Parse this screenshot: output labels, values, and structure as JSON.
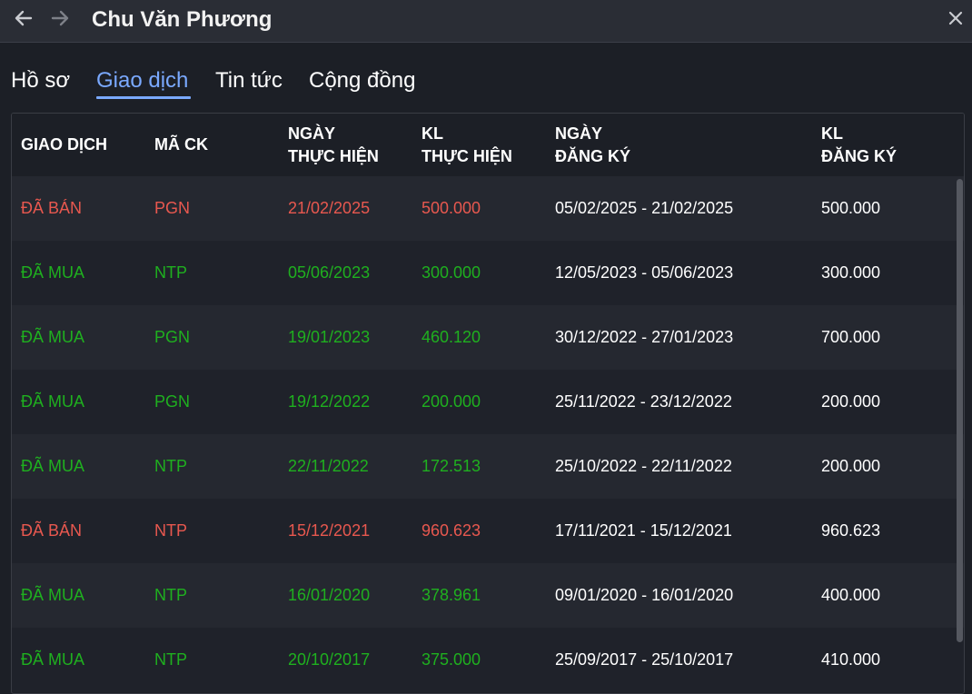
{
  "window": {
    "title": "Chu Văn Phương",
    "back_icon": "arrow-left-icon",
    "forward_icon": "arrow-right-icon",
    "close_icon": "close-icon"
  },
  "tabs": [
    {
      "label": "Hồ sơ",
      "active": false
    },
    {
      "label": "Giao dịch",
      "active": true
    },
    {
      "label": "Tin tức",
      "active": false
    },
    {
      "label": "Cộng đồng",
      "active": false
    }
  ],
  "colors": {
    "accent": "#7aa9ff",
    "sell": "#e8584f",
    "buy": "#1fb01f"
  },
  "table": {
    "headers": [
      "GIAO DỊCH",
      "MÃ CK",
      "NGÀY\nTHỰC HIỆN",
      "KL\nTHỰC HIỆN",
      "NGÀY\nĐĂNG KÝ",
      "KL\nĐĂNG KÝ"
    ],
    "rows": [
      {
        "type": "sell",
        "cells": [
          "ĐÃ BÁN",
          "PGN",
          "21/02/2025",
          "500.000",
          "05/02/2025 - 21/02/2025",
          "500.000"
        ]
      },
      {
        "type": "buy",
        "cells": [
          "ĐÃ MUA",
          "NTP",
          "05/06/2023",
          "300.000",
          "12/05/2023 - 05/06/2023",
          "300.000"
        ]
      },
      {
        "type": "buy",
        "cells": [
          "ĐÃ MUA",
          "PGN",
          "19/01/2023",
          "460.120",
          "30/12/2022 - 27/01/2023",
          "700.000"
        ]
      },
      {
        "type": "buy",
        "cells": [
          "ĐÃ MUA",
          "PGN",
          "19/12/2022",
          "200.000",
          "25/11/2022 - 23/12/2022",
          "200.000"
        ]
      },
      {
        "type": "buy",
        "cells": [
          "ĐÃ MUA",
          "NTP",
          "22/11/2022",
          "172.513",
          "25/10/2022 - 22/11/2022",
          "200.000"
        ]
      },
      {
        "type": "sell",
        "cells": [
          "ĐÃ BÁN",
          "NTP",
          "15/12/2021",
          "960.623",
          "17/11/2021 - 15/12/2021",
          "960.623"
        ]
      },
      {
        "type": "buy",
        "cells": [
          "ĐÃ MUA",
          "NTP",
          "16/01/2020",
          "378.961",
          "09/01/2020 - 16/01/2020",
          "400.000"
        ]
      },
      {
        "type": "buy",
        "cells": [
          "ĐÃ MUA",
          "NTP",
          "20/10/2017",
          "375.000",
          "25/09/2017 - 25/10/2017",
          "410.000"
        ]
      }
    ]
  }
}
